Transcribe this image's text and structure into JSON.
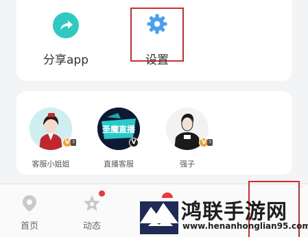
{
  "features": {
    "share_label": "分享app",
    "settings_label": "设置"
  },
  "service": {
    "agents": [
      {
        "name": "客服小姐姐",
        "badge": "V",
        "tag": "3"
      },
      {
        "name": "直播客服",
        "logo_text": "圣魔直播",
        "badge": "V"
      },
      {
        "name": "强子",
        "badge": "V",
        "tag": "3"
      }
    ]
  },
  "nav": {
    "home_label": "首页",
    "feed_label": "动态"
  },
  "watermark": {
    "title": "鸿联手游网",
    "url": "www.henanhonglian95.com"
  },
  "colors": {
    "accent_teal": "#2ec9c0",
    "gear_blue": "#4a9ff0",
    "highlight_red": "#d42a2a",
    "dot_red": "#e83a3a"
  }
}
